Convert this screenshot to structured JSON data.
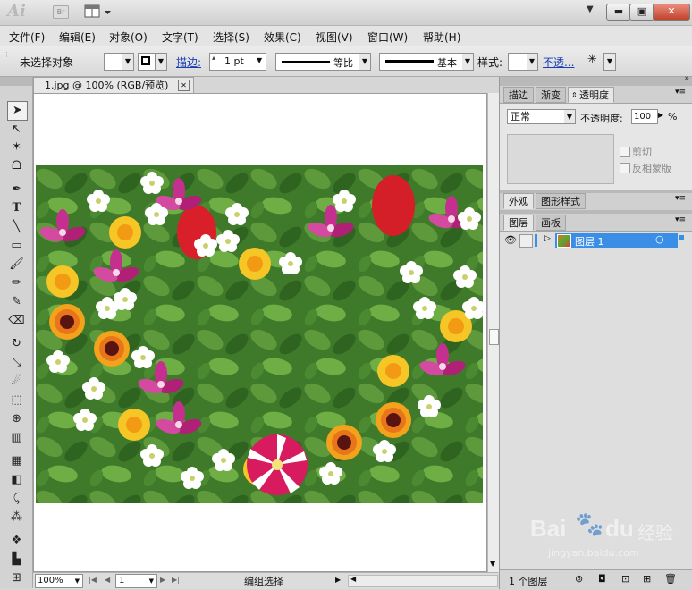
{
  "titlebar": {
    "logo": "Ai",
    "bridge": "Br"
  },
  "menus": [
    "文件(F)",
    "编辑(E)",
    "对象(O)",
    "文字(T)",
    "选择(S)",
    "效果(C)",
    "视图(V)",
    "窗口(W)",
    "帮助(H)"
  ],
  "control": {
    "no_selection": "未选择对象",
    "stroke_label": "描边:",
    "stroke_weight": "1 pt",
    "profile_label": "等比",
    "brush_label": "基本",
    "style_label": "样式:",
    "opacity_link": "不透..."
  },
  "document": {
    "tab_title": "1.jpg @ 100% (RGB/预览)",
    "zoom": "100%",
    "page": "1",
    "status": "编组选择"
  },
  "transparency_panel": {
    "tabs": [
      "描边",
      "渐变",
      "透明度"
    ],
    "blend_mode": "正常",
    "opacity_label": "不透明度:",
    "opacity_value": "100",
    "opacity_unit": "%",
    "clip_label": "剪切",
    "invert_mask_label": "反相蒙版"
  },
  "appearance_panel": {
    "tabs": [
      "外观",
      "图形样式"
    ]
  },
  "layers_panel": {
    "tabs": [
      "图层",
      "画板"
    ],
    "layer_name": "图层 1",
    "footer": "1 个图层"
  },
  "watermark": {
    "brand": "Bai",
    "brand2": "du",
    "label": "经验",
    "url": "jingyan.baidu.com"
  },
  "colors": {
    "layer_selected": "#3b8ee6",
    "panel_bg": "#d0d0d0",
    "accent_link": "#1a3fb5"
  }
}
